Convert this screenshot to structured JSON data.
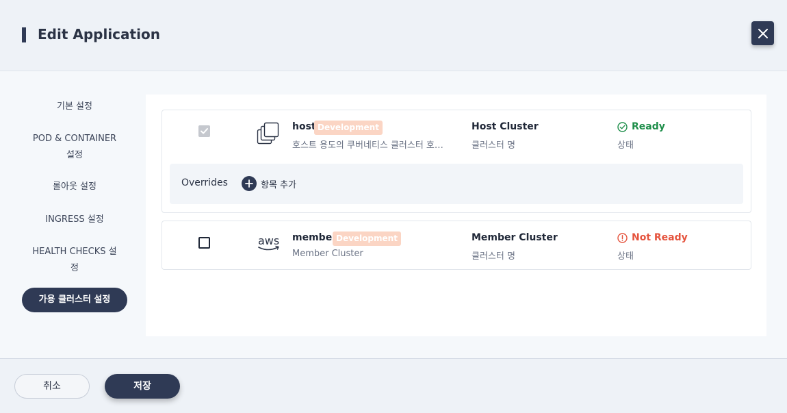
{
  "header": {
    "title": "Edit Application"
  },
  "nav": {
    "items": [
      {
        "label": "기본 설정"
      },
      {
        "label_line1": "POD & CONTAINER",
        "label_line2": "설정"
      },
      {
        "label": "롤아웃 설정"
      },
      {
        "label": "INGRESS 설정"
      },
      {
        "label_line1": "HEALTH CHECKS 설",
        "label_line2": "정"
      },
      {
        "label": "가용 클러스터 설정",
        "active": true
      }
    ]
  },
  "clusters": [
    {
      "checked": true,
      "logo": "cluster-stack-icon",
      "name": "host",
      "badge": "Development",
      "description": "호스트 용도의 쿠버네티스 클러스터 호…",
      "cluster_name": "Host Cluster",
      "cluster_name_label": "클러스터 명",
      "status": "Ready",
      "status_label": "상태",
      "status_color": "#1e8e4a",
      "overrides": {
        "label": "Overrides",
        "add_label": "항목 추가"
      }
    },
    {
      "checked": false,
      "logo": "aws-logo",
      "logo_text": "aws",
      "name": "member",
      "badge": "Development",
      "description": "Member Cluster",
      "cluster_name": "Member Cluster",
      "cluster_name_label": "클러스터 명",
      "status": "Not Ready",
      "status_label": "상태",
      "status_color": "#e5533d"
    }
  ],
  "footer": {
    "cancel_label": "취소",
    "save_label": "저장"
  },
  "colors": {
    "accent": "#2f3a55",
    "badge": "#fbd5c4",
    "ready": "#1e8e4a",
    "not_ready": "#e5533d"
  }
}
